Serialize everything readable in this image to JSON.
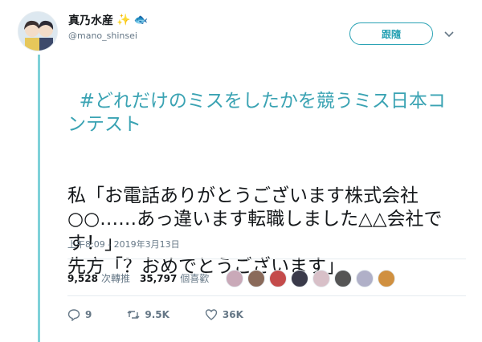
{
  "user": {
    "display_name": "真乃水産",
    "emojis": [
      "sparkle-icon",
      "fish-icon"
    ],
    "handle": "@mano_shinsei"
  },
  "follow_label": "跟隨",
  "tweet": {
    "hashtag": "#どれだけのミスをしたかを競うミス日本コンテスト",
    "body": "私「お電話ありがとうございます株式会社○○……あっ違います転職しました△△会社です！」\n先方「？おめでとうございます」",
    "timestamp": "上午8:09 - 2019年3月13日"
  },
  "stats": {
    "retweets": "9,528",
    "retweets_label": "次轉推",
    "likes": "35,797",
    "likes_label": "個喜歡"
  },
  "likers": [
    {
      "color": "#c9a9b8"
    },
    {
      "color": "#8a6a5a"
    },
    {
      "color": "#c44b4b"
    },
    {
      "color": "#3a3a4a"
    },
    {
      "color": "#d8c0c8"
    },
    {
      "color": "#555555"
    },
    {
      "color": "#b0b0c8"
    },
    {
      "color": "#d09040"
    }
  ],
  "actions": {
    "replies": "9",
    "retweets": "9.5K",
    "likes": "36K"
  },
  "colors": {
    "accent": "#29a2b4",
    "thread_line": "#7fd1d9"
  }
}
